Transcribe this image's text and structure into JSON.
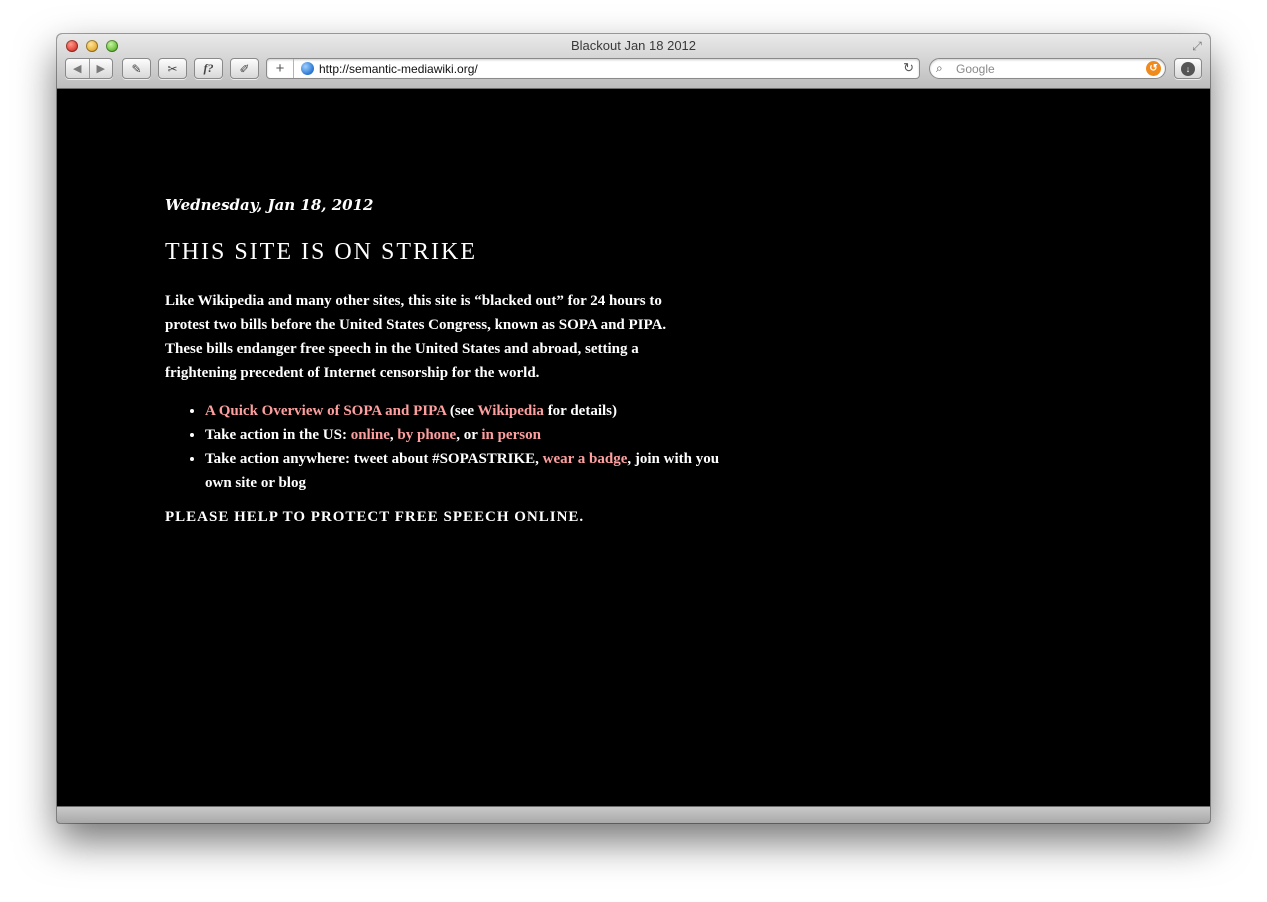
{
  "window": {
    "title": "Blackout Jan 18 2012"
  },
  "toolbar": {
    "back_icon": "back-arrow-icon",
    "forward_icon": "forward-arrow-icon",
    "b1_glyph": "✎",
    "b2_glyph": "✂",
    "b3_glyph": "f?",
    "b4_glyph": "✐",
    "add_glyph": "+",
    "url": "http://semantic-mediawiki.org/",
    "reload_glyph": "↻",
    "search_placeholder": "Google",
    "search_glyph": "⌕",
    "snap_glyph": "↺",
    "download_glyph": "↓"
  },
  "article": {
    "date": "Wednesday, Jan 18, 2012",
    "headline": "THIS SITE IS ON STRIKE",
    "intro": "Like Wikipedia and many other sites, this site is “blacked out” for 24 hours to protest two bills before the United States Congress, known as SOPA and PIPA. These bills endanger free speech in the United States and abroad, setting a frightening precedent of Internet censorship for the world.",
    "bullet1": {
      "link1": "A Quick Overview of SOPA and PIPA",
      "text1": " (see ",
      "link2": "Wikipedia",
      "text2": " for details)"
    },
    "bullet2": {
      "text1": "Take action in the US: ",
      "link1": "online",
      "text2": ", ",
      "link2": "by phone",
      "text3": ", or ",
      "link3": "in person"
    },
    "bullet3": {
      "text1": "Take action anywhere: tweet about #SOPASTRIKE, ",
      "link1": "wear a badge",
      "text2": ", join with you own site or blog"
    },
    "closing": "PLEASE HELP TO PROTECT FREE SPEECH ONLINE."
  },
  "colors": {
    "background": "#000000",
    "text": "#ffffff",
    "link": "#ff9f9f"
  }
}
